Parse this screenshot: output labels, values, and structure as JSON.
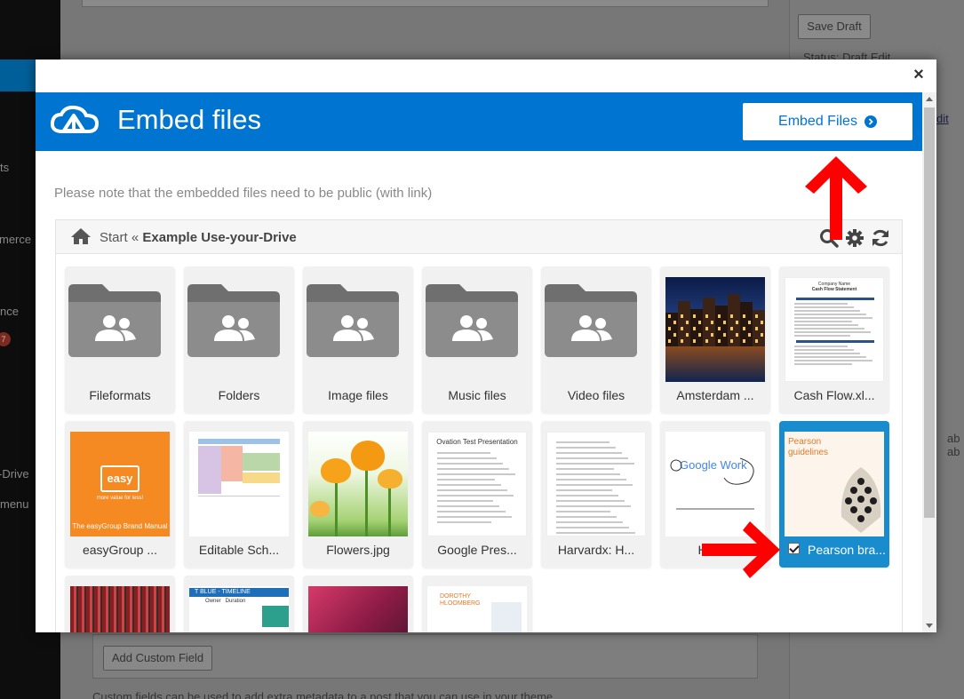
{
  "background": {
    "sidebar_items": [
      "ts",
      "merce",
      "nce",
      "-Drive",
      "menu"
    ],
    "sidebar_badge": "7",
    "save_draft": "Save Draft",
    "status": "Status: Draft Edit",
    "edit_link": "dit",
    "tab_text": "ab ab",
    "add_custom_field": "Add Custom Field",
    "custom_fields_note": "Custom fields can be used to add extra metadata to a post that you can use in your theme."
  },
  "modal": {
    "close_label": "×",
    "header": {
      "title": "Embed files",
      "embed_button": "Embed Files"
    },
    "note": "Please note that the embedded files need to be public (with link)",
    "browser": {
      "breadcrumb_start": "Start «",
      "breadcrumb_current": "Example Use-your-Drive"
    },
    "items": [
      {
        "label": "Fileformats",
        "kind": "folder"
      },
      {
        "label": "Folders",
        "kind": "folder"
      },
      {
        "label": "Image files",
        "kind": "folder"
      },
      {
        "label": "Music files",
        "kind": "folder"
      },
      {
        "label": "Video files",
        "kind": "folder"
      },
      {
        "label": "Amsterdam ...",
        "kind": "image"
      },
      {
        "label": "Cash Flow.xl...",
        "kind": "sheet"
      },
      {
        "label": "easyGroup ...",
        "kind": "pdf"
      },
      {
        "label": "Editable Sch...",
        "kind": "sheet"
      },
      {
        "label": "Flowers.jpg",
        "kind": "image"
      },
      {
        "label": "Google Pres...",
        "kind": "slides"
      },
      {
        "label": "Harvardx: H...",
        "kind": "doc"
      },
      {
        "label": "How...",
        "kind": "doc"
      },
      {
        "label": "Pearson bra...",
        "kind": "pdf",
        "selected": true
      },
      {
        "label": "",
        "kind": "image"
      },
      {
        "label": "",
        "kind": "sheet"
      },
      {
        "label": "",
        "kind": "image"
      },
      {
        "label": "",
        "kind": "doc"
      }
    ],
    "thumb_text": {
      "cash_flow_title": "Company Name",
      "cash_flow_sub": "Cash Flow Statement",
      "easy_logo": "easy",
      "easy_tag": "more value for less!",
      "easy_footer": "The easyGroup Brand Manual",
      "google_pres_title": "Ovation Test Presentation",
      "google_logo": "Google Work",
      "pearson_title": "Pearson",
      "pearson_sub": "guidelines",
      "timeline_title": "T BLUE - TIMELINE",
      "timeline_headers": "Owner   Duration",
      "resume_name": "DOROTHY HLOOMBERG"
    }
  },
  "colors": {
    "header_blue": "#0074d1",
    "selected_tile": "#188ccd",
    "annotation_arrow": "#ff0000"
  },
  "icons": [
    "cloud-logo-icon",
    "arrow-circle-right-icon",
    "close-icon",
    "home-icon",
    "search-icon",
    "gear-icon",
    "refresh-icon",
    "folder-shared-icon",
    "checkbox-icon"
  ]
}
